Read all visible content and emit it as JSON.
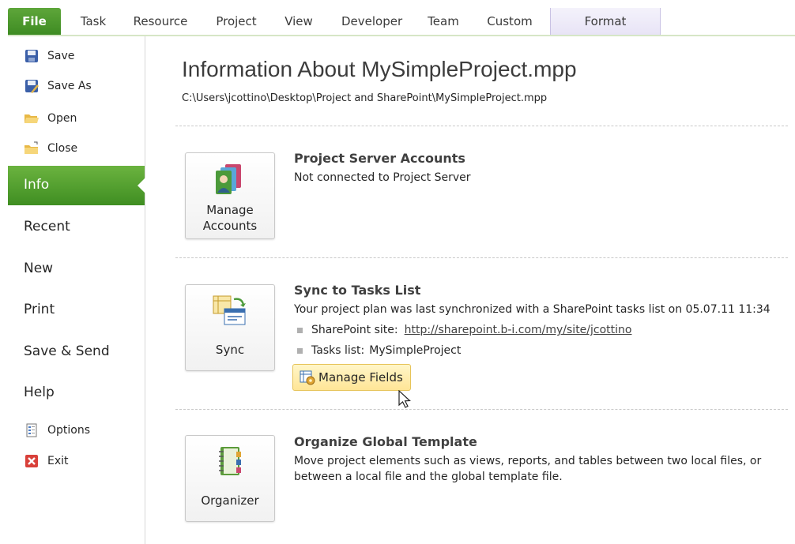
{
  "ribbon": {
    "tabs": [
      "File",
      "Task",
      "Resource",
      "Project",
      "View",
      "Developer",
      "Team",
      "Custom",
      "Format"
    ]
  },
  "nav": {
    "save": "Save",
    "save_as": "Save As",
    "open": "Open",
    "close": "Close",
    "info": "Info",
    "recent": "Recent",
    "new": "New",
    "print": "Print",
    "save_send": "Save & Send",
    "help": "Help",
    "options": "Options",
    "exit": "Exit"
  },
  "main": {
    "title": "Information About MySimpleProject.mpp",
    "path": "C:\\Users\\jcottino\\Desktop\\Project and SharePoint\\MySimpleProject.mpp",
    "accounts": {
      "button_line1": "Manage",
      "button_line2": "Accounts",
      "title": "Project Server Accounts",
      "text": "Not connected to Project Server"
    },
    "sync": {
      "button": "Sync",
      "title": "Sync to Tasks List",
      "text": "Your project plan was last synchronized with a SharePoint tasks list on 05.07.11 11:34",
      "site_label": "SharePoint site:",
      "site_url": "http://sharepoint.b-i.com/my/site/jcottino",
      "list_label": "Tasks list:",
      "list_value": "MySimpleProject",
      "manage_fields": "Manage Fields"
    },
    "organizer": {
      "button": "Organizer",
      "title": "Organize Global Template",
      "text_line1": "Move project elements such as views, reports, and tables between two local files, or",
      "text_line2": "between a local file and the global template file."
    }
  },
  "colors": {
    "file_tab": "#3c8a21",
    "info_highlight": "#4f9e2c",
    "manage_fields_bg": "#ffe596"
  }
}
